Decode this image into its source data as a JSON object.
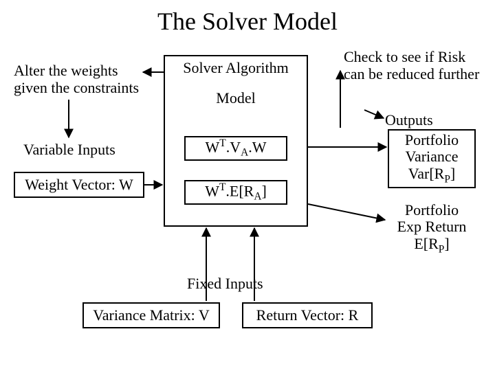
{
  "title": "The Solver Model",
  "left_note": "Alter the weights given the constraints",
  "right_note": "Check to see if Risk can be reduced further",
  "solver_algo_label": "Solver Algorithm",
  "model_label": "Model",
  "variable_inputs_label": "Variable Inputs",
  "weight_vector_label": "Weight Vector: W",
  "formula1_parts": {
    "pre": "W",
    "sup1": "T",
    "mid": ".V",
    "sub1": "A",
    "post": ".W"
  },
  "formula2_parts": {
    "pre": "W",
    "sup1": "T",
    "mid": ".E[R",
    "sub1": "A",
    "post": "]"
  },
  "outputs_label": "Outputs",
  "output1_parts": {
    "l1": "Portfolio",
    "l2": "Variance",
    "l3pre": "Var[R",
    "l3sub": "P",
    "l3post": "]"
  },
  "output2_parts": {
    "l1": "Portfolio",
    "l2": "Exp Return",
    "l3pre": "E[R",
    "l3sub": "P",
    "l3post": "]"
  },
  "fixed_inputs_label": "Fixed Inputs",
  "variance_matrix_label": "Variance Matrix: V",
  "return_vector_label": "Return Vector: R"
}
